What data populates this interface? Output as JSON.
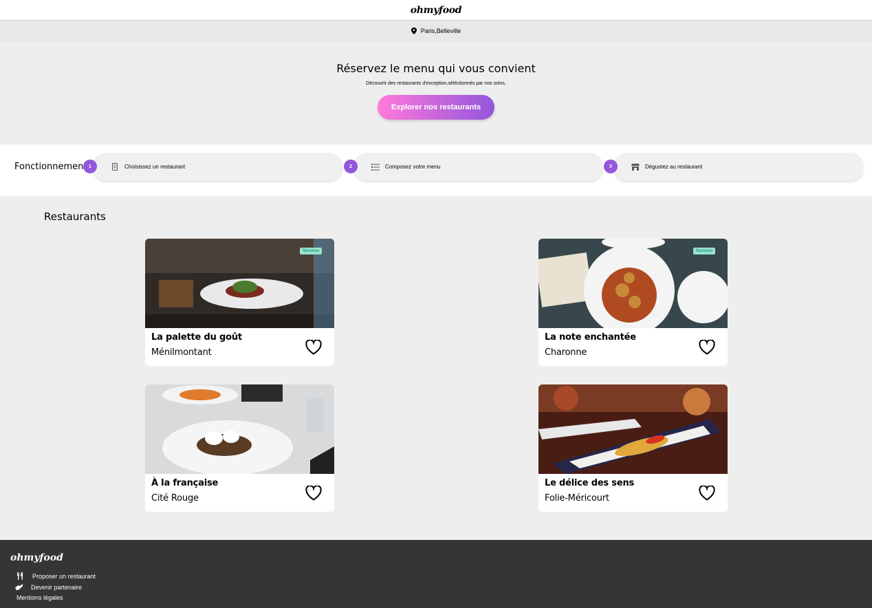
{
  "header": {
    "logo": "ohmyfood",
    "location": "Paris,Belleville"
  },
  "hero": {
    "title": "Réservez le menu qui vous convient",
    "subtitle": "Découvrir des restaurants d'exception,séléctionnés par nos soins.",
    "cta_label": "Explorer nos restaurants"
  },
  "steps": {
    "title": "Fonctionnement",
    "items": [
      {
        "num": "1",
        "label": "Choisissez un restaurant",
        "icon": "phone-icon"
      },
      {
        "num": "2",
        "label": "Composez votre menu",
        "icon": "list-icon"
      },
      {
        "num": "3",
        "label": "Dégustez au restaurant",
        "icon": "store-icon"
      }
    ]
  },
  "restaurants": {
    "title": "Restaurants",
    "badge": "Nouveau",
    "cards": [
      {
        "name": "La palette du goût",
        "area": "Ménilmontant",
        "new": true
      },
      {
        "name": "La note enchantée",
        "area": "Charonne",
        "new": true
      },
      {
        "name": "À la française",
        "area": "Cité Rouge",
        "new": false
      },
      {
        "name": "Le délice des sens",
        "area": "Folie-Méricourt",
        "new": false
      }
    ]
  },
  "footer": {
    "logo": "ohmyfood",
    "links": [
      {
        "label": "Proposer un restaurant",
        "icon": "utensils-icon"
      },
      {
        "label": "Devenir partenaire",
        "icon": "handshake-icon"
      },
      {
        "label": "Mentions légales",
        "icon": ""
      }
    ]
  }
}
